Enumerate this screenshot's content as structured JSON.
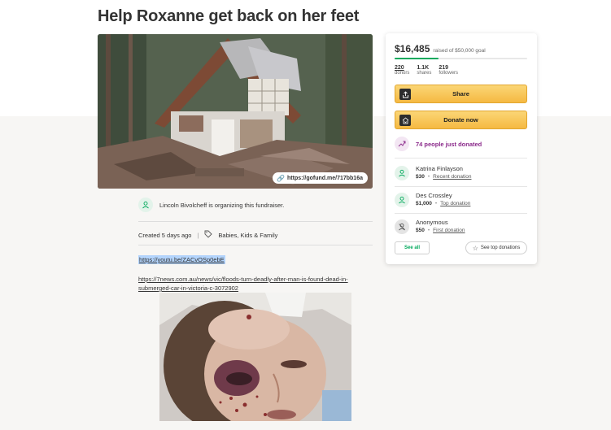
{
  "campaign": {
    "title": "Help Roxanne get back on her feet",
    "share_url": "https://gofund.me/717bb16a",
    "organizer_text": "Lincoln Bivolcheff is organizing this fundraiser.",
    "created": "Created 5 days ago",
    "category": "Babies, Kids & Family",
    "youtube_link": "https://youtu.be/ZACvOSp0ebE",
    "news_link": "https://7news.com.au/news/vic/floods-turn-deadly-after-man-is-found-dead-in-submerged-car-in-victoria-c-3072902"
  },
  "donation_panel": {
    "amount_raised": "$16,485",
    "goal_text": "raised of $50,000 goal",
    "progress_fraction": 0.33,
    "stats": [
      {
        "value": "220",
        "label": "donors"
      },
      {
        "value": "1.1K",
        "label": "shares"
      },
      {
        "value": "219",
        "label": "followers"
      }
    ],
    "share_label": "Share",
    "donate_label": "Donate now",
    "trending_text": "74 people just donated",
    "donors": [
      {
        "name": "Katrina Finlayson",
        "amount": "$30",
        "tag": "Recent donation"
      },
      {
        "name": "Des Crossley",
        "amount": "$1,000",
        "tag": "Top donation"
      },
      {
        "name": "Anonymous",
        "amount": "$50",
        "tag": "First donation"
      }
    ],
    "see_all_label": "See all",
    "see_top_label": "See top donations"
  },
  "colors": {
    "brand_green": "#02a95c",
    "button_yellow": "#f5b942",
    "trend_purple": "#8b2a8b"
  }
}
